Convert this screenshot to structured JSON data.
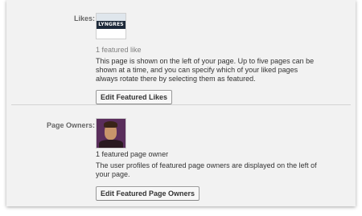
{
  "likes": {
    "label": "Likes:",
    "thumbnail_text": "LYNGRES",
    "count_text": "1 featured like",
    "description": "This page is shown on the left of your page. Up to five pages can be shown at a time, and you can specify which of your liked pages always rotate there by selecting them as featured.",
    "button_label": "Edit Featured Likes"
  },
  "page_owners": {
    "label": "Page Owners:",
    "count_text": "1 featured page owner",
    "description": "The user profiles of featured page owners are displayed on the left of your page.",
    "button_label": "Edit Featured Page Owners"
  },
  "colors": {
    "panel_background": "#f2f2f2",
    "label_text": "#666666",
    "muted_text": "#808080",
    "divider": "#d4d4d4"
  }
}
